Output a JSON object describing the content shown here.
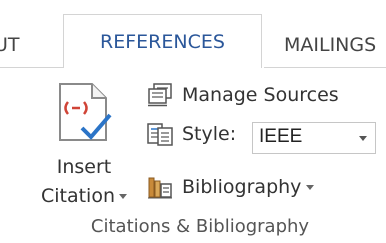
{
  "tabs": {
    "prev_label": "UT",
    "active_label": "REFERENCES",
    "next_label": "MAILINGS"
  },
  "citations_group": {
    "insert_citation_line1": "Insert",
    "insert_citation_line2": "Citation",
    "manage_sources_label": "Manage Sources",
    "style_label": "Style:",
    "style_value": "IEEE",
    "bibliography_label": "Bibliography",
    "group_label": "Citations & Bibliography"
  },
  "colors": {
    "accent": "#2b579a",
    "citation_red": "#d04437",
    "checkmark_blue": "#2b74c7"
  },
  "icons": {
    "insert_citation": "document-citation-check-icon",
    "manage_sources": "manage-sources-icon",
    "style": "style-icon",
    "bibliography": "bibliography-icon",
    "style_dropdown": "chevron-down-icon"
  }
}
